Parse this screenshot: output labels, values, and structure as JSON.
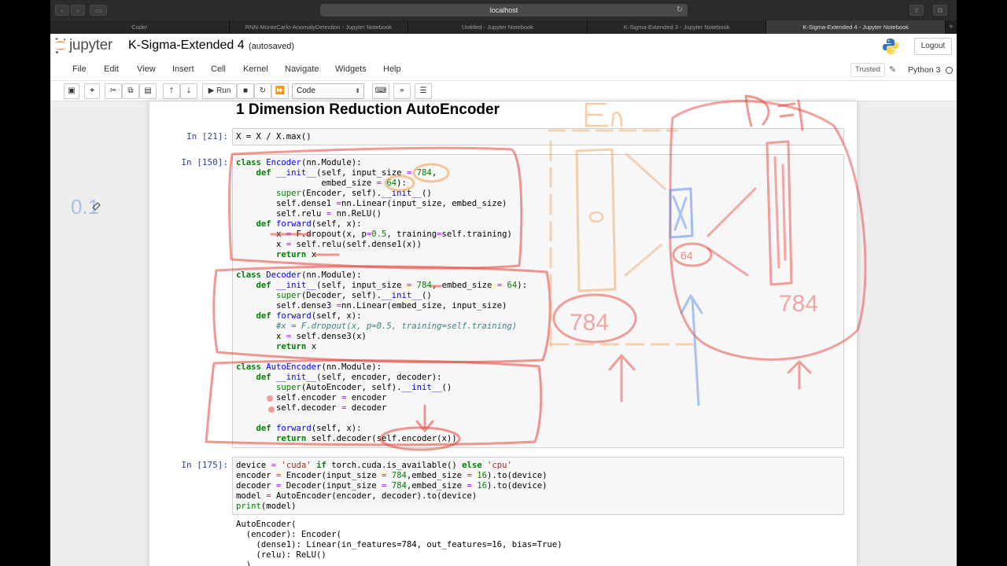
{
  "browser": {
    "url": "localhost",
    "tabs": [
      {
        "label": "Code/",
        "active": false
      },
      {
        "label": "RNN-MonteCarlo-AnomalyDetection - Jupyter Notebook",
        "active": false
      },
      {
        "label": "Untitled - Jupyter Notebook",
        "active": false
      },
      {
        "label": "K-Sigma-Extended 3 - Jupyter Notebook",
        "active": false
      },
      {
        "label": "K-Sigma-Extended 4 - Jupyter Notebook",
        "active": true
      }
    ],
    "new_tab_glyph": "+"
  },
  "header": {
    "logo_text": "jupyter",
    "notebook_title": "K-Sigma-Extended 4",
    "status": "(autosaved)",
    "logout_label": "Logout"
  },
  "menubar": {
    "items": [
      "File",
      "Edit",
      "View",
      "Insert",
      "Cell",
      "Kernel",
      "Navigate",
      "Widgets",
      "Help"
    ],
    "trusted_label": "Trusted",
    "kernel_name": "Python 3"
  },
  "toolbar": {
    "run_label": "Run",
    "cell_type": "Code"
  },
  "notebook": {
    "heading": "1  Dimension Reduction AutoEncoder",
    "cells": [
      {
        "prompt": "In [21]:",
        "code": [
          "X = X / X.max()"
        ]
      },
      {
        "prompt": "In [150]:"
      },
      {
        "prompt": "In [175]:"
      }
    ],
    "output": [
      "AutoEncoder(",
      "  (encoder): Encoder(",
      "    (dense1): Linear(in_features=784, out_features=16, bias=True)",
      "    (relu): ReLU()",
      "  )"
    ]
  },
  "annotations": {
    "side_note": "0.1",
    "encoder_label": "En",
    "decoder_label": "De",
    "dims": [
      "784",
      "784",
      "64"
    ]
  },
  "colors": {
    "ink_red": "#e8443a",
    "ink_orange": "#f0a35a",
    "ink_blue": "#5b8def",
    "prompt_blue": "#303f9f"
  }
}
